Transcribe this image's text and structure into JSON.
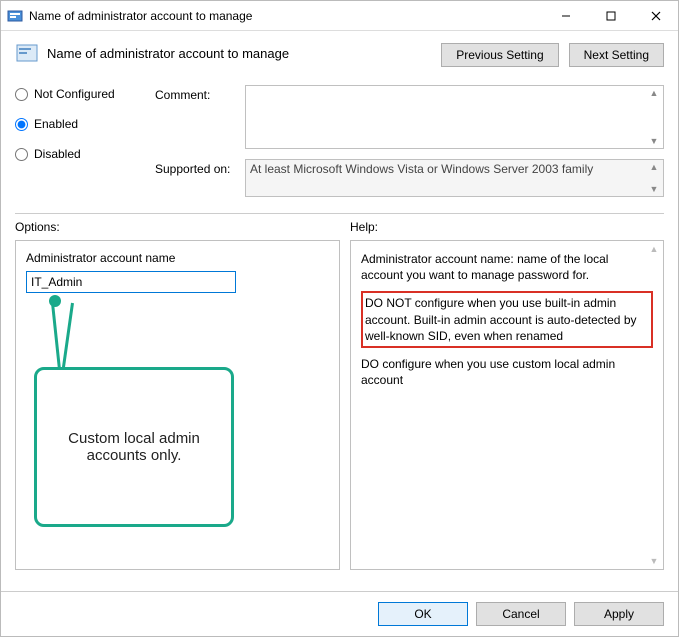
{
  "window": {
    "title": "Name of administrator account to manage"
  },
  "header": {
    "title": "Name of administrator account to manage",
    "prev_btn": "Previous Setting",
    "next_btn": "Next Setting"
  },
  "state": {
    "not_configured": "Not Configured",
    "enabled": "Enabled",
    "disabled": "Disabled",
    "selected": "enabled"
  },
  "fields": {
    "comment_label": "Comment:",
    "comment_value": "",
    "supported_label": "Supported on:",
    "supported_value": "At least Microsoft Windows Vista or Windows Server 2003 family"
  },
  "labels": {
    "options": "Options:",
    "help": "Help:"
  },
  "options": {
    "admin_name_label": "Administrator account name",
    "admin_name_value": "IT_Admin"
  },
  "callout": {
    "text": "Custom local admin accounts only."
  },
  "help": {
    "p1": "Administrator account name: name of the local account you want to manage password for.",
    "p2": " DO NOT configure when you use built-in admin account. Built-in admin account is auto-detected by well-known SID, even when renamed",
    "p3": " DO configure when you use custom local admin account"
  },
  "footer": {
    "ok": "OK",
    "cancel": "Cancel",
    "apply": "Apply"
  }
}
